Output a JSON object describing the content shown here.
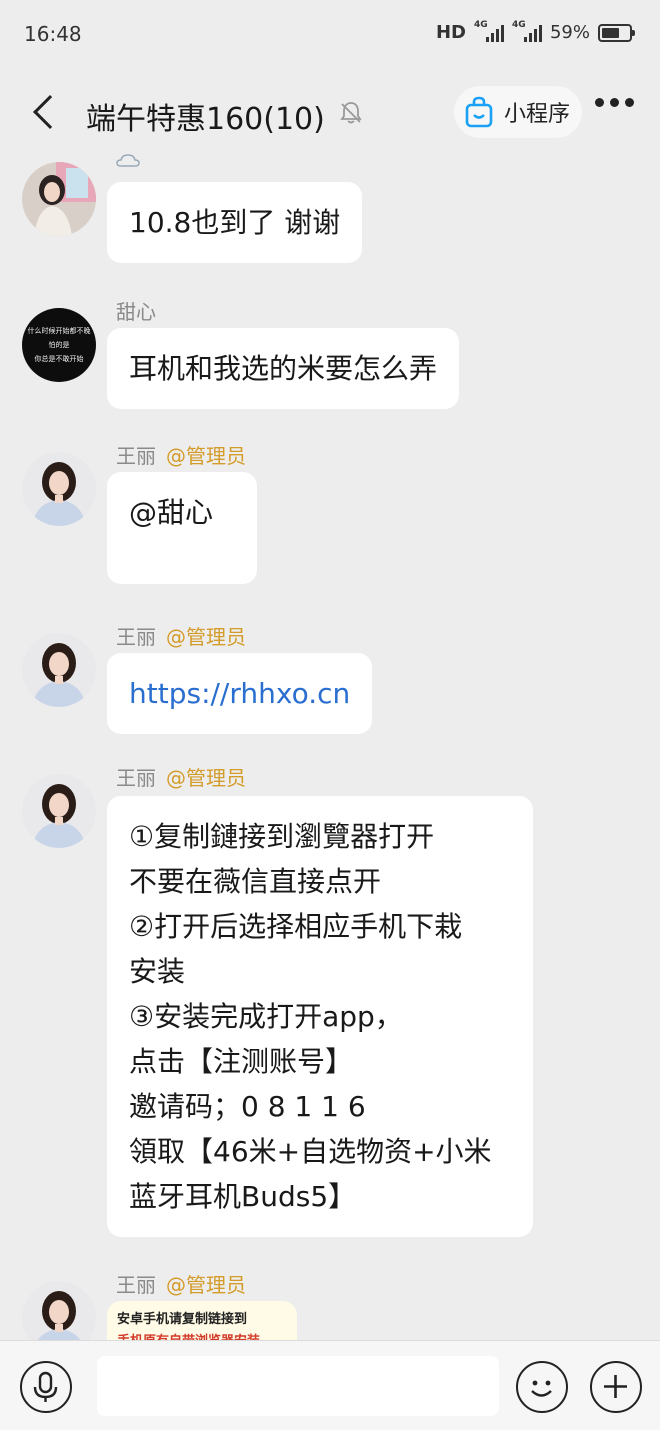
{
  "status_bar": {
    "time": "16:48",
    "hd": "HD",
    "network_1": "4G",
    "network_2": "4G",
    "battery": "59%"
  },
  "header": {
    "title": "端午特惠160(10)",
    "mini_program_label": "小程序",
    "accent": "#1aa1f5"
  },
  "messages": [
    {
      "sender": "",
      "role": "",
      "text": "10.8也到了 谢谢",
      "avatar": "woman-photo"
    },
    {
      "sender": "甜心",
      "role": "",
      "text": "耳机和我选的米要怎么弄",
      "avatar": "dark-text"
    },
    {
      "sender": "王丽",
      "role": "@管理员",
      "text": "@甜心",
      "avatar": "woman-shirt"
    },
    {
      "sender": "王丽",
      "role": "@管理员",
      "text": "https://rhhxo.cn",
      "avatar": "woman-shirt"
    },
    {
      "sender": "王丽",
      "role": "@管理员",
      "lines": [
        "①复制鏈接到瀏覽器打开",
        "不要在薇信直接点开",
        "②打开后选择相应手机下栽",
        "安装",
        "③安装完成打开app，",
        "点击【注测账号】",
        "邀请码；0 8 1 1 6",
        "領取【46米+自选物资+小米",
        "蓝牙耳机Buds5】"
      ],
      "avatar": "woman-shirt"
    },
    {
      "sender": "王丽",
      "role": "@管理员",
      "image_text": [
        "安卓手机请复制链接到",
        "手机原有自带浏览器安装"
      ],
      "avatar": "woman-shirt"
    }
  ],
  "avatar_dark_text": [
    "什么时候开始都不晚",
    "怕的是",
    "你总是不敢开始"
  ],
  "colors": {
    "background": "#ededed",
    "bubble": "#ffffff",
    "link": "#2a6fd0",
    "role": "#d49c2a"
  }
}
